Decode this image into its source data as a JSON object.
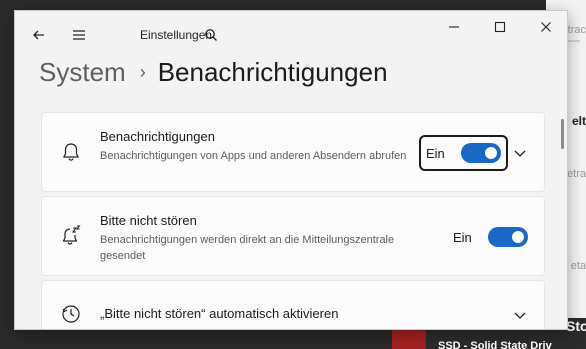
{
  "window": {
    "app_title": "Einstellungen",
    "minimize_icon": "minimize-icon",
    "maximize_icon": "maximize-icon",
    "close_icon": "close-icon"
  },
  "breadcrumb": {
    "parent": "System",
    "separator": "›",
    "current": "Benachrichtigungen"
  },
  "settings": [
    {
      "title": "Benachrichtigungen",
      "description": "Benachrichtigungen von Apps und anderen Absendern abrufen",
      "toggle_label": "Ein",
      "toggle_on": true,
      "icon": "bell-icon",
      "expandable": true
    },
    {
      "title": "Bitte nicht stören",
      "description": "Benachrichtigungen werden direkt an die Mitteilungszentrale gesendet",
      "toggle_label": "Ein",
      "toggle_on": true,
      "icon": "bell-snooze-icon"
    },
    {
      "title": "„Bitte nicht stören“ automatisch aktivieren",
      "icon": "clock-icon",
      "expandable": true
    }
  ],
  "background_app": {
    "texts": [
      "etrac",
      "elt",
      "Betra",
      "eta",
      "Sto",
      "SSD - Solid State Driv"
    ]
  },
  "colors": {
    "accent": "#1868c6",
    "window_bg": "#f3f3f3",
    "card_bg": "#fbfbfb"
  }
}
